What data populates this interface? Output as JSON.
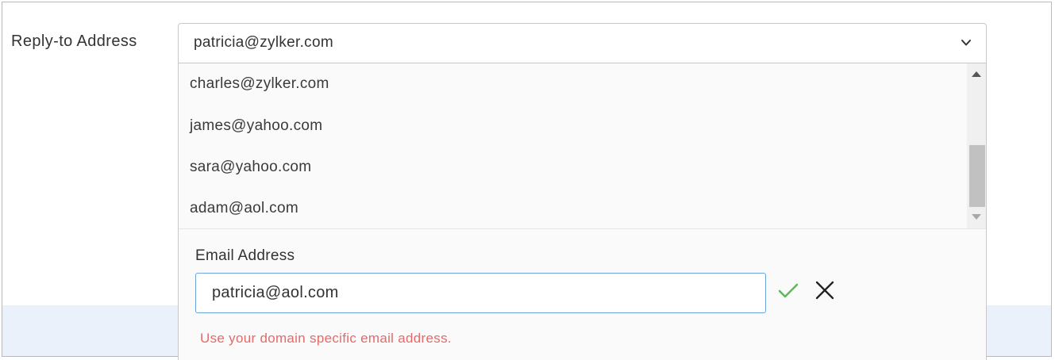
{
  "field": {
    "label": "Reply-to Address",
    "selected_value": "patricia@zylker.com"
  },
  "dropdown": {
    "options": [
      "charles@zylker.com",
      "james@yahoo.com",
      "sara@yahoo.com",
      "adam@aol.com"
    ]
  },
  "add_email": {
    "label": "Email Address",
    "value": "patricia@aol.com",
    "error": "Use your domain specific email address."
  },
  "colors": {
    "input_focus_border": "#69a5dc",
    "confirm_green": "#5cb85c",
    "error_red": "#e26b6b",
    "band_background": "#ebf1fa"
  },
  "icons": {
    "chevron": "chevron-down-icon",
    "confirm": "check-icon",
    "cancel": "close-icon"
  }
}
